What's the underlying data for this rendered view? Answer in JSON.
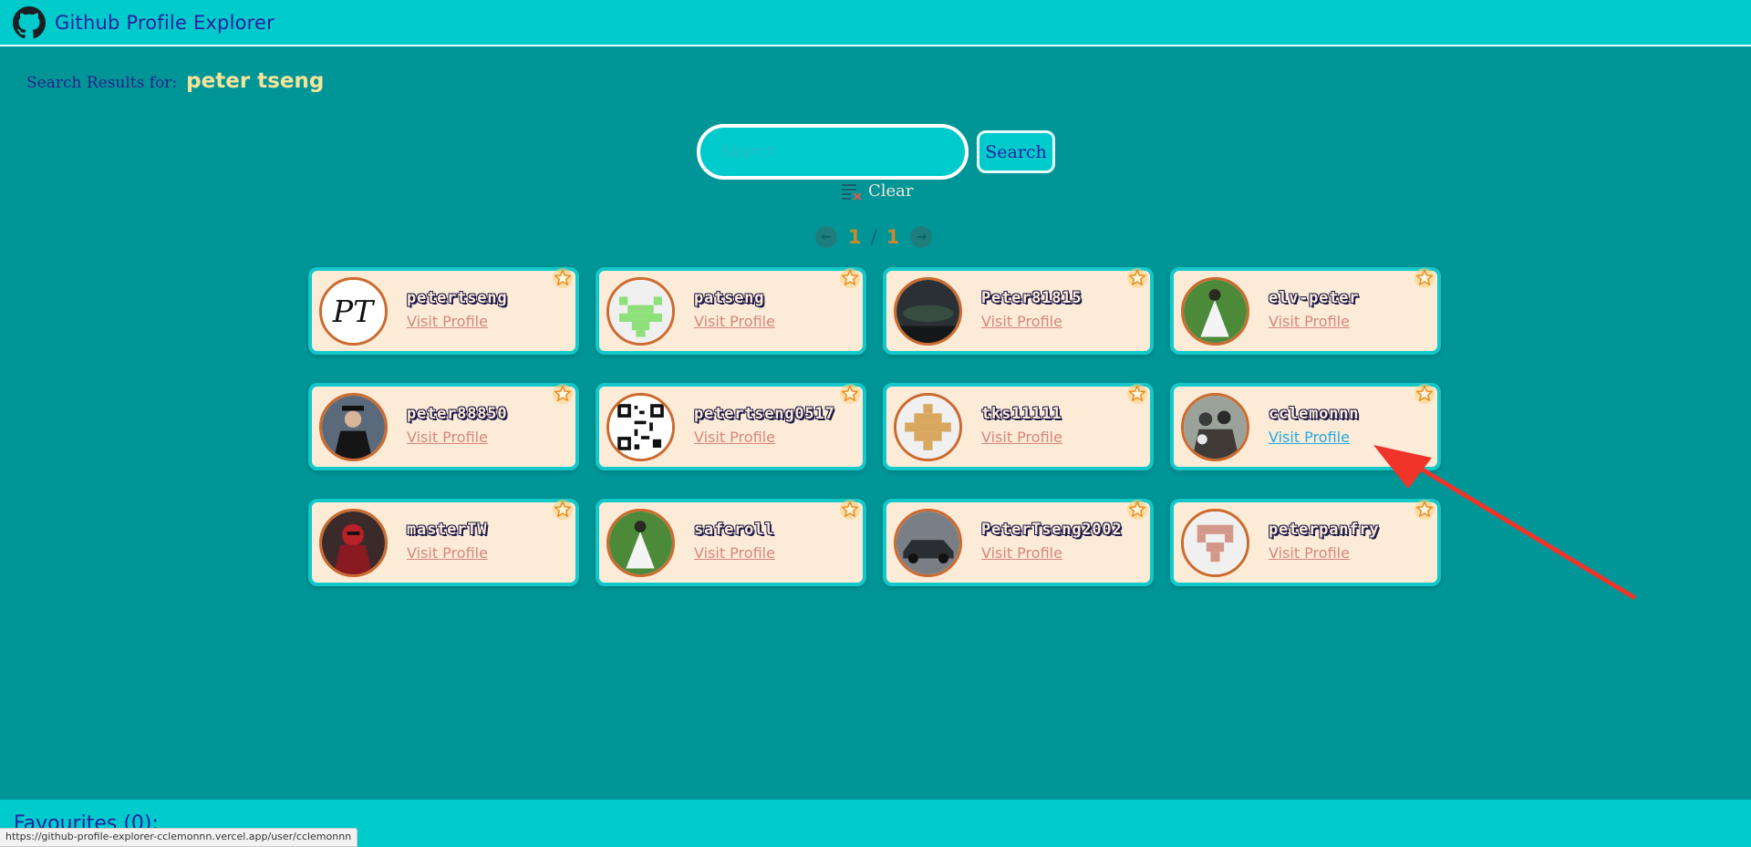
{
  "header": {
    "title": "Github Profile Explorer",
    "logo_icon": "github-icon"
  },
  "search_results": {
    "label": "Search Results for:",
    "query": "peter tseng"
  },
  "search": {
    "placeholder": "Search",
    "value": "",
    "button_label": "Search",
    "clear_label": "Clear"
  },
  "pagination": {
    "current": "1",
    "separator": "/",
    "total": "1"
  },
  "users": [
    {
      "username": "petertseng",
      "link": "Visit Profile",
      "avatar": "pt-letters"
    },
    {
      "username": "patseng",
      "link": "Visit Profile",
      "avatar": "green-identicon"
    },
    {
      "username": "Peter81815",
      "link": "Visit Profile",
      "avatar": "night-sky-photo"
    },
    {
      "username": "elv-peter",
      "link": "Visit Profile",
      "avatar": "white-dress-photo"
    },
    {
      "username": "peter88850",
      "link": "Visit Profile",
      "avatar": "graduate-photo"
    },
    {
      "username": "petertseng0517",
      "link": "Visit Profile",
      "avatar": "qr-code"
    },
    {
      "username": "tks11111",
      "link": "Visit Profile",
      "avatar": "tan-identicon"
    },
    {
      "username": "cclemonnn",
      "link": "Visit Profile",
      "avatar": "group-photo"
    },
    {
      "username": "masterTW",
      "link": "Visit Profile",
      "avatar": "superhero-photo"
    },
    {
      "username": "saferoll",
      "link": "Visit Profile",
      "avatar": "white-dress-photo"
    },
    {
      "username": "PeterTseng2002",
      "link": "Visit Profile",
      "avatar": "car-photo"
    },
    {
      "username": "peterpanfry",
      "link": "Visit Profile",
      "avatar": "pink-identicon"
    }
  ],
  "favourites": {
    "label": "Favourites (0):"
  },
  "status_bar": {
    "url": "https://github-profile-explorer-cclemonnn.vercel.app/user/cclemonnn"
  },
  "colors": {
    "background": "#009698",
    "header": "#00cbcc",
    "card": "#fcebd7",
    "card_border": "#13c8c9",
    "link": "#d6877d",
    "link_hover": "#27a8e0",
    "star": "#f0a030",
    "annotation_arrow": "#f0342a"
  }
}
